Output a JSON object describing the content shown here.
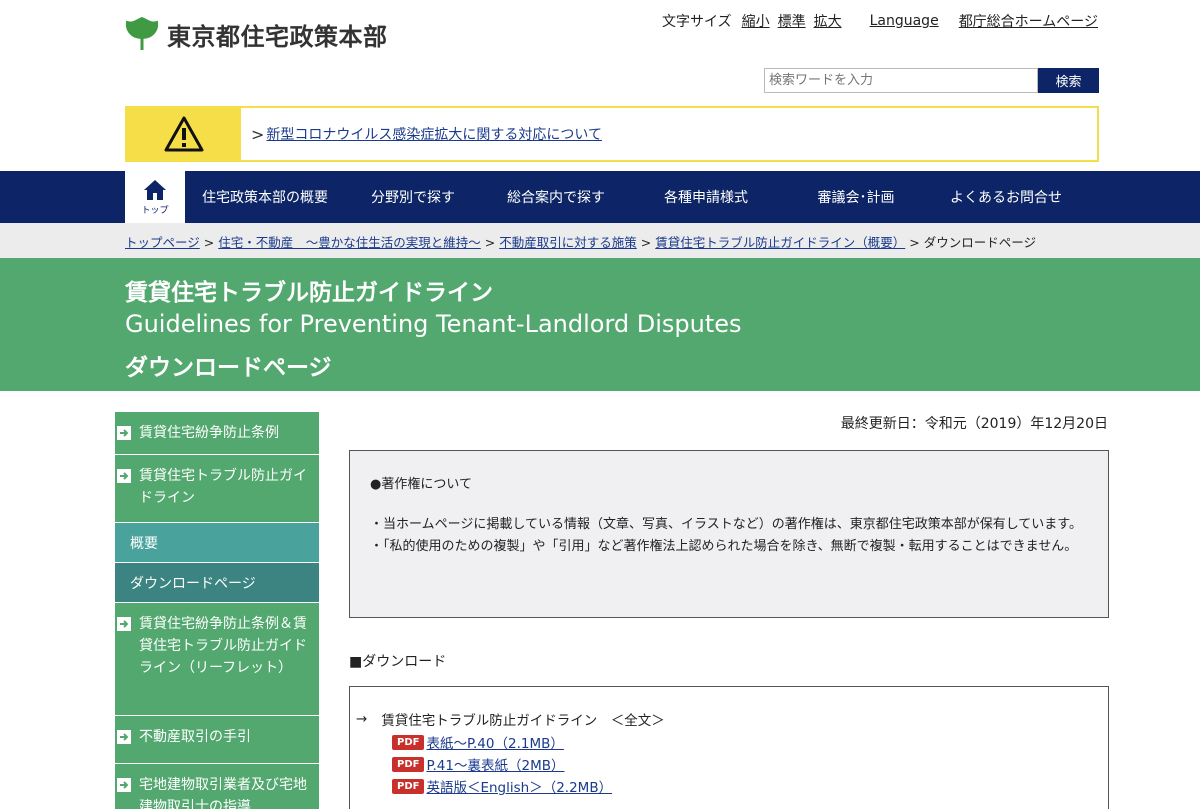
{
  "header": {
    "site_name": "東京都住宅政策本部",
    "font_size_label": "文字サイズ",
    "font_small": "縮小",
    "font_standard": "標準",
    "font_large": "拡大",
    "language": "Language",
    "tokyo_home": "都庁総合ホームページ",
    "search_placeholder": "検索ワードを入力",
    "search_button": "検索"
  },
  "alert": {
    "arrow": ">",
    "text": "新型コロナウイルス感染症拡大に関する対応について"
  },
  "nav": {
    "home_label": "トップ",
    "items": [
      "住宅政策本部の概要",
      "分野別で探す",
      "総合案内で探す",
      "各種申請様式",
      "審議会･計画",
      "よくあるお問合せ"
    ]
  },
  "breadcrumb": {
    "items": [
      "トップページ",
      "住宅・不動産　～豊かな住生活の実現と維持～",
      "不動産取引に対する施策",
      "賃貸住宅トラブル防止ガイドライン（概要）"
    ],
    "current": "ダウンロードページ",
    "sep": ">"
  },
  "title": {
    "line1": "賃貸住宅トラブル防止ガイドライン",
    "line2": "Guidelines for Preventing Tenant-Landlord Disputes",
    "line3": "ダウンロードページ"
  },
  "sidebar": {
    "items": [
      "賃貸住宅紛争防止条例",
      "賃貸住宅トラブル防止ガイドライン",
      "賃貸住宅紛争防止条例＆賃貸住宅トラブル防止ガイドライン（リーフレット）",
      "不動産取引の手引",
      "宅地建物取引業者及び宅地建物取引士の指導"
    ],
    "subitems": [
      "概要",
      "ダウンロードページ"
    ]
  },
  "main": {
    "updated": "最終更新日：令和元（2019）年12月20日",
    "copyright_heading": "●著作権について",
    "copyright_b1": "・当ホームページに掲載している情報（文章、写真、イラストなど）の著作権は、東京都住宅政策本部が保有しています。",
    "copyright_b2": "・「私的使用のための複製」や「引用」など著作権法上認められた場合を除き、無断で複製・転用することはできません。",
    "download_heading": "■ダウンロード",
    "dl_arrow": "→",
    "dl_title": "賃貸住宅トラブル防止ガイドライン　＜全文＞",
    "pdf_label": "PDF",
    "links": [
      "表紙～P.40（2.1MB）",
      "P.41～裏表紙（2MB）",
      "英語版＜English＞（2.2MB）"
    ]
  },
  "colors": {
    "navy": "#0d2566",
    "green": "#52a86f",
    "teal": "#4aa29c",
    "teal_active": "#3b8481",
    "alert_yellow": "#f5de48",
    "pdf_red": "#c8302c"
  }
}
